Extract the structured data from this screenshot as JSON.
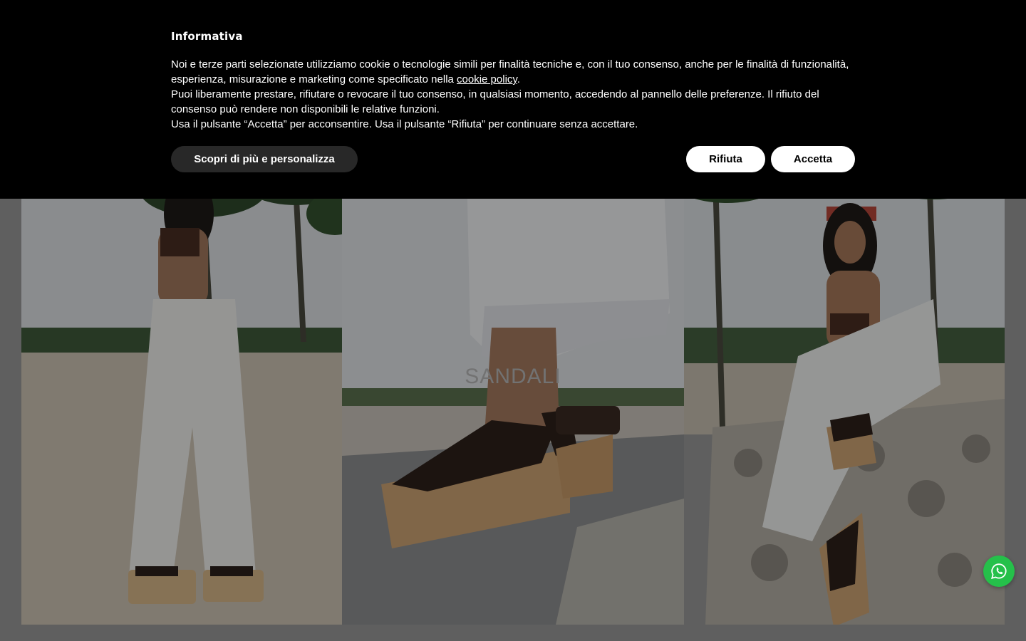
{
  "cookie_banner": {
    "title": "Informativa",
    "p1_before_link": "Noi e terze parti selezionate utilizziamo cookie o tecnologie simili per finalità tecniche e, con il tuo consenso, anche per le finalità di funzionalità, esperienza, misurazione e marketing come specificato nella ",
    "p1_link": "cookie policy",
    "p1_after_link": ".",
    "p2": "Puoi liberamente prestare, rifiutare o revocare il tuo consenso, in qualsiasi momento, accedendo al pannello delle preferenze. Il rifiuto del consenso può rendere non disponibili le relative funzioni.",
    "p3": "Usa il pulsante “Accetta” per acconsentire. Usa il pulsante “Rifiuta” per continuare senza accettare.",
    "customize_label": "Scopri di più e personalizza",
    "reject_label": "Rifiuta",
    "accept_label": "Accetta"
  },
  "hero": {
    "title": "SANDALI"
  },
  "icons": {
    "chat": "whatsapp-icon"
  },
  "colors": {
    "banner_bg": "#000000",
    "customize_bg": "#282828",
    "whatsapp": "#25c04a"
  }
}
